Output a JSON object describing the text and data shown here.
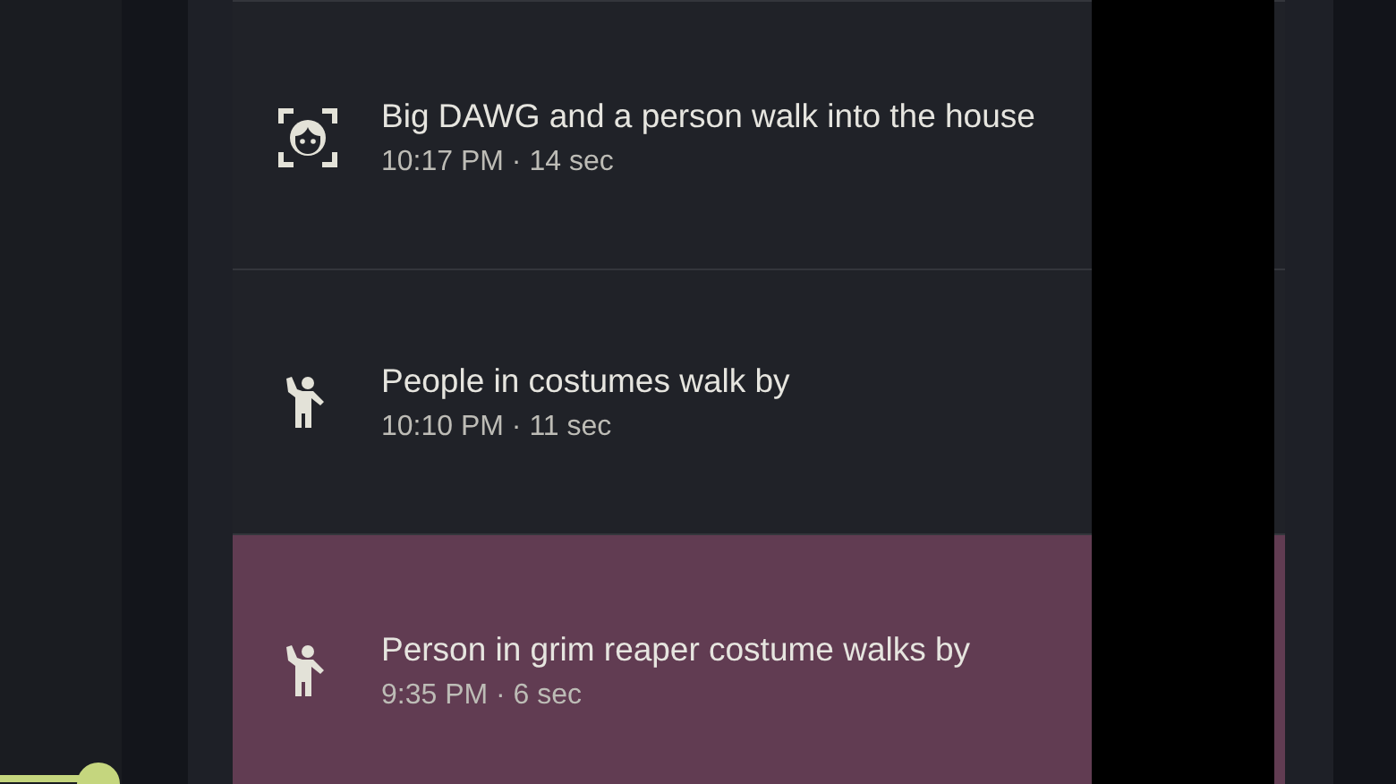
{
  "events": [
    {
      "kind": "face",
      "title": "Big DAWG and a person walk into the house",
      "time": "10:17 PM · 14 sec",
      "selected": false
    },
    {
      "kind": "person",
      "title": "People in costumes walk by",
      "time": "10:10 PM · 11 sec",
      "selected": false
    },
    {
      "kind": "person",
      "title": "Person in grim reaper costume walks by",
      "time": "9:35 PM · 6 sec",
      "selected": true
    }
  ]
}
